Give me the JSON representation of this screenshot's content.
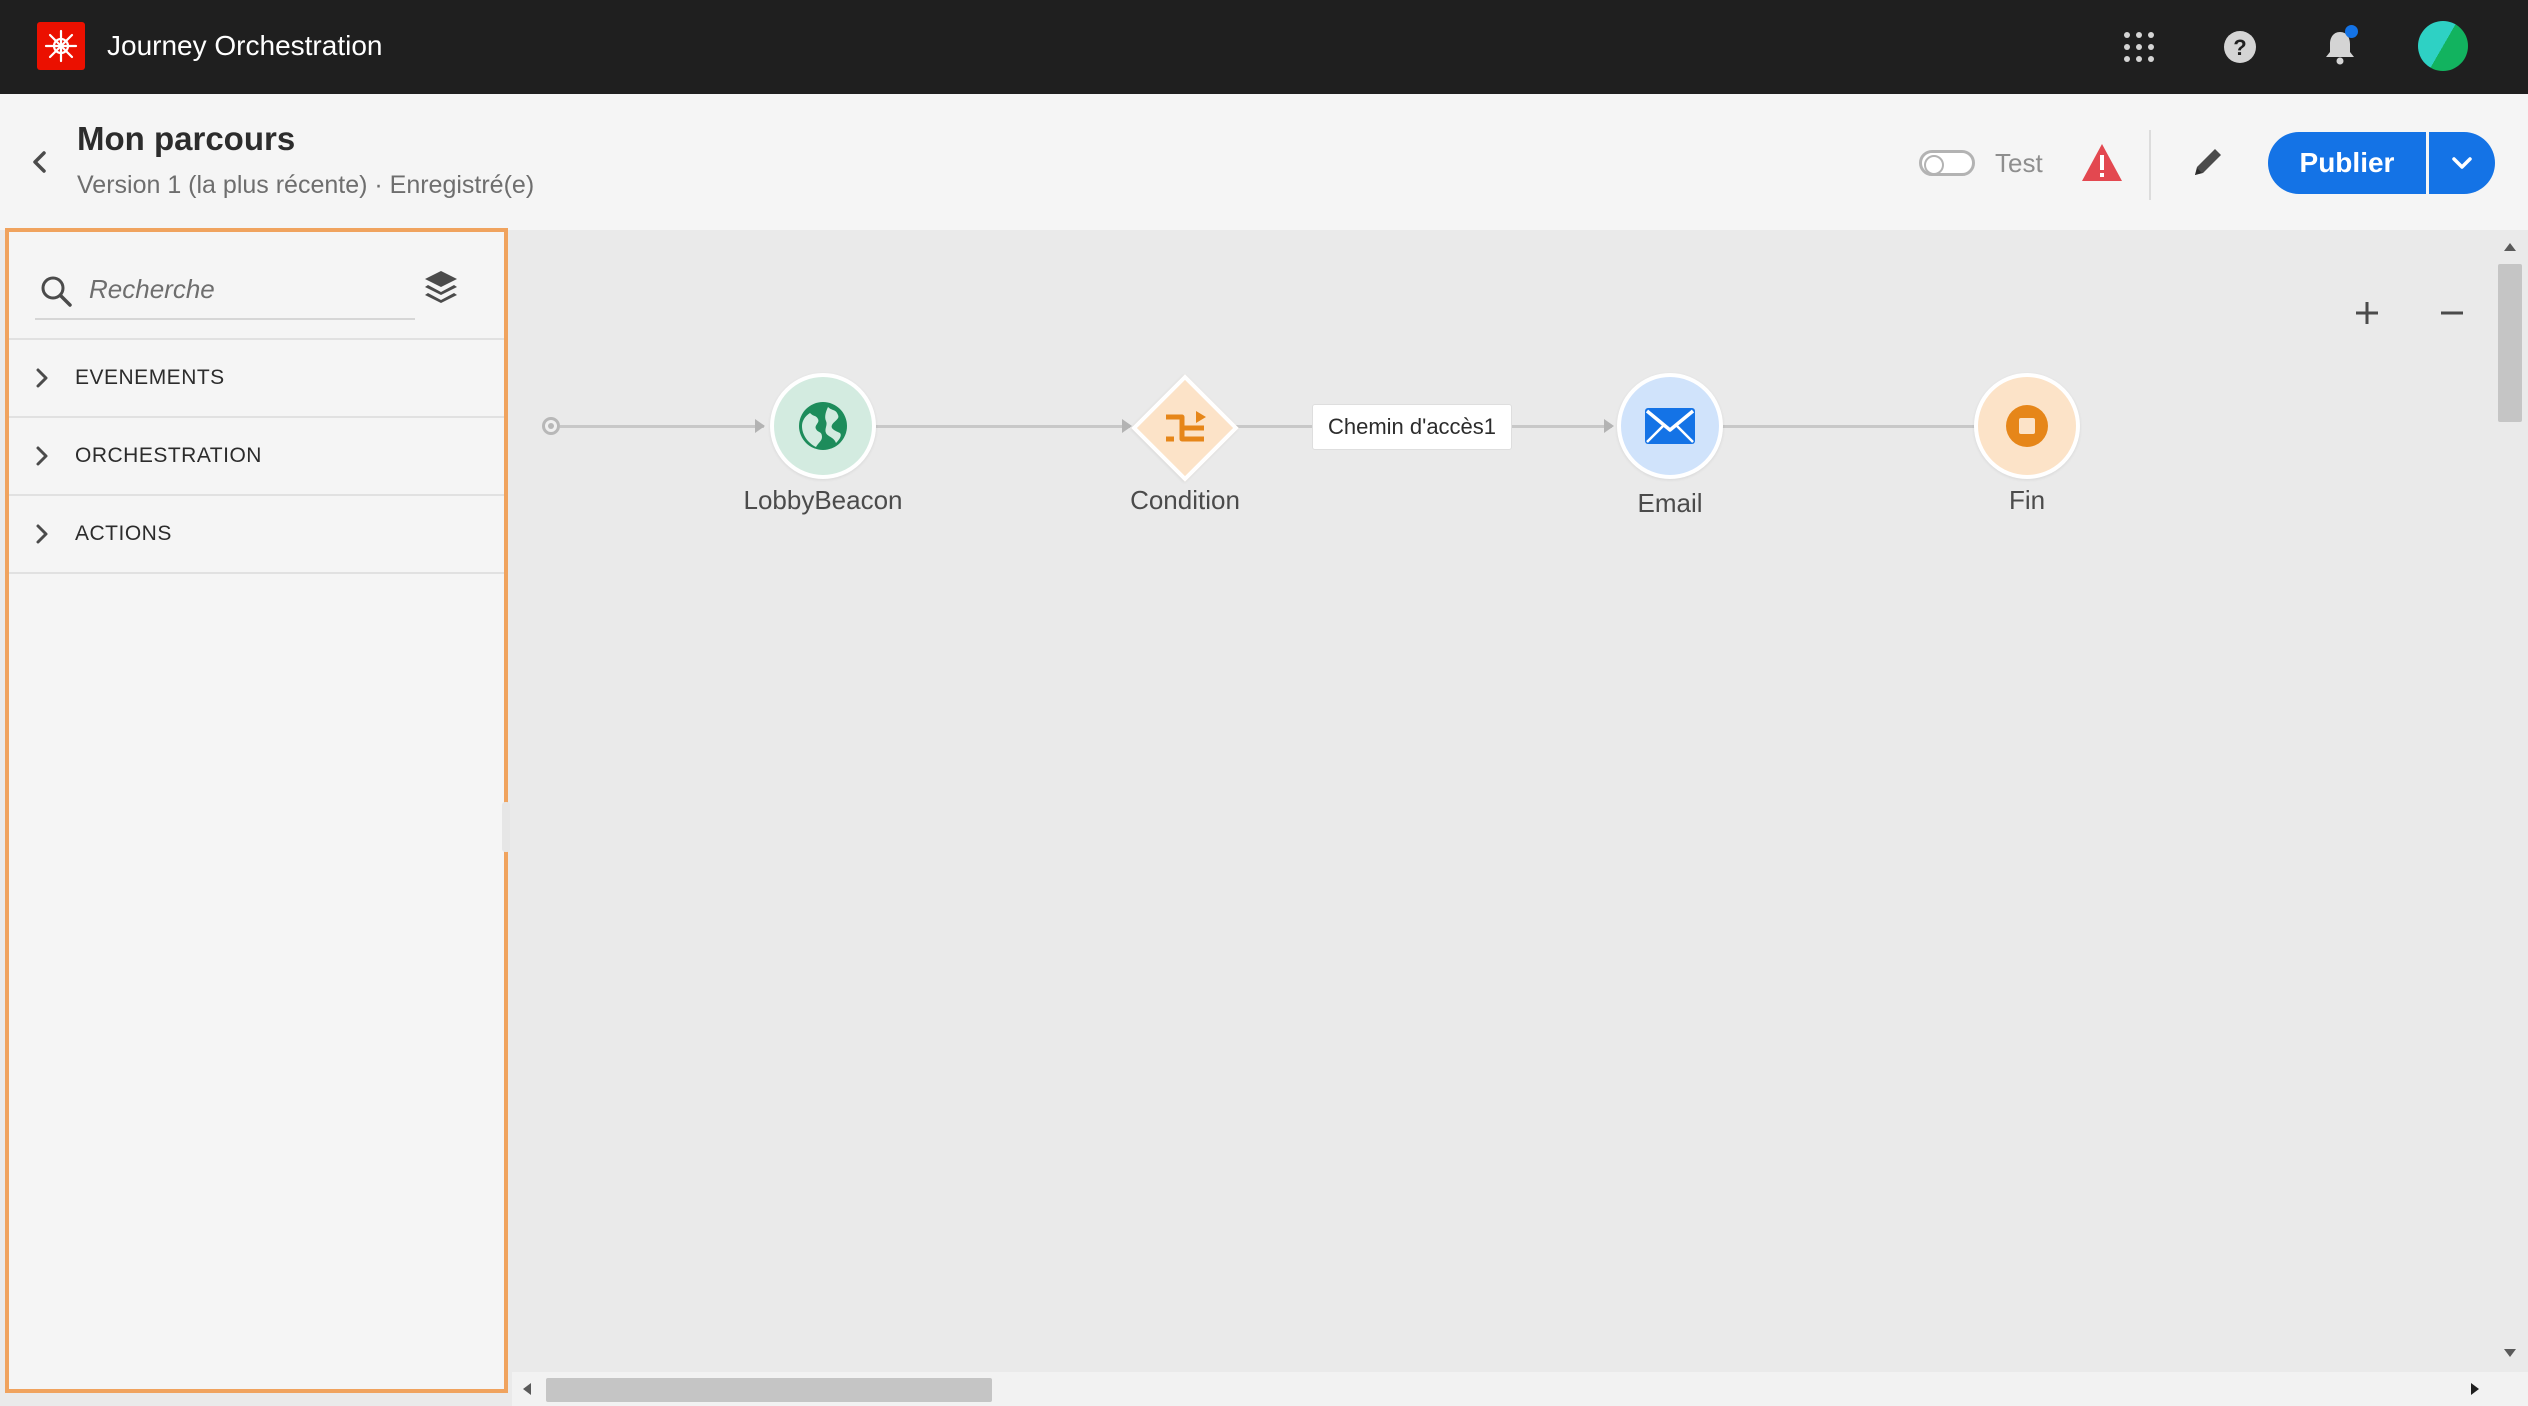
{
  "app": {
    "title": "Journey Orchestration",
    "logo_icon": "adobe-logo-icon",
    "logo_color": "#eb1000",
    "icons": [
      "apps-grid-icon",
      "help-icon",
      "bell-icon",
      "avatar"
    ],
    "notification_dot_color": "#1473e6"
  },
  "header": {
    "title": "Mon parcours",
    "subtitle": "Version 1 (la plus récente) · Enregistré(e)",
    "test_toggle_label": "Test",
    "test_toggle_on": false,
    "warning_color": "#e34850",
    "publish_label": "Publier",
    "accent_color": "#1473e6"
  },
  "palette": {
    "search_placeholder": "Recherche",
    "highlight_color": "#f0a35e",
    "sections": [
      {
        "label": "EVENEMENTS"
      },
      {
        "label": "ORCHESTRATION"
      },
      {
        "label": "ACTIONS"
      }
    ]
  },
  "canvas": {
    "zoom_in_symbol": "+",
    "zoom_out_symbol": "−",
    "nodes": [
      {
        "label": "LobbyBeacon",
        "type": "event",
        "icon": "globe-icon",
        "color": "#1d8c5b",
        "bg": "#d3ebe0"
      },
      {
        "label": "Condition",
        "type": "condition",
        "icon": "split-path-icon",
        "color": "#e68619",
        "bg": "#fce3c8"
      },
      {
        "label": "Email",
        "type": "action",
        "icon": "mail-icon",
        "color": "#1473e6",
        "bg": "#d0e3fb"
      },
      {
        "label": "Fin",
        "type": "end",
        "icon": "stop-icon",
        "color": "#e68619",
        "bg": "#fce3c8"
      }
    ],
    "path_label": "Chemin d'accès1"
  }
}
